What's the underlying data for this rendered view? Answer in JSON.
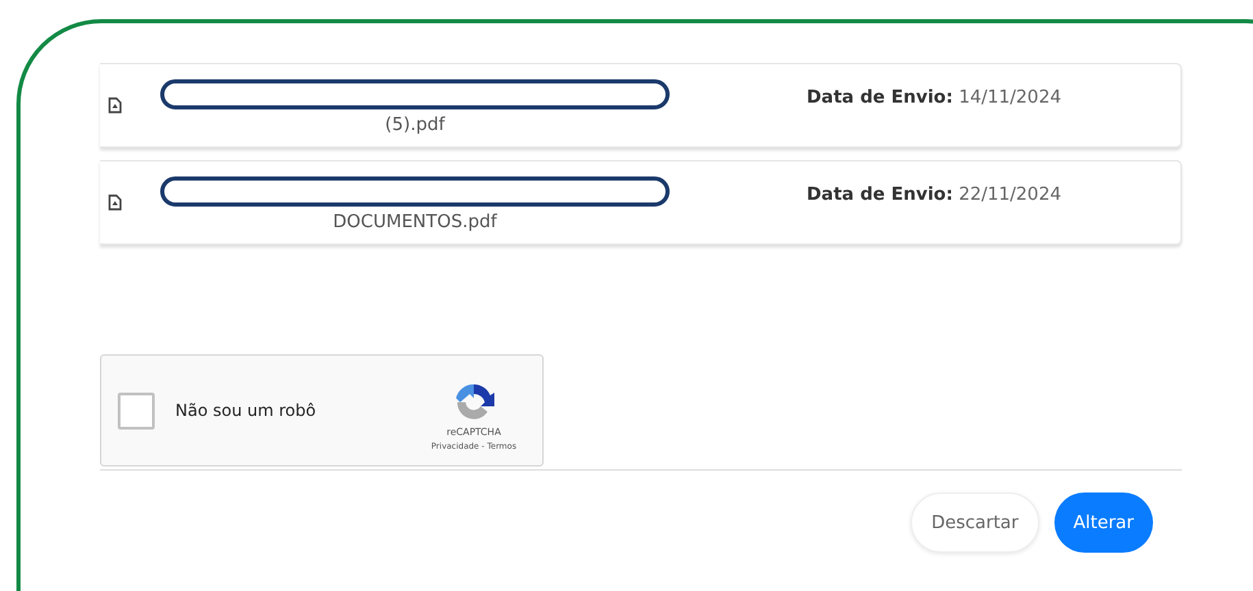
{
  "files": [
    {
      "name": "(5).pdf",
      "date_label": "Data de Envio:",
      "date": "14/11/2024"
    },
    {
      "name": "DOCUMENTOS.pdf",
      "date_label": "Data de Envio:",
      "date": "22/11/2024"
    }
  ],
  "captcha": {
    "label": "Não sou um robô",
    "checked": false,
    "brand": "reCAPTCHA",
    "links": "Privacidade - Termos"
  },
  "buttons": [
    {
      "label": "Descartar",
      "kind": "secondary"
    },
    {
      "label": "Alterar",
      "kind": "primary"
    }
  ]
}
